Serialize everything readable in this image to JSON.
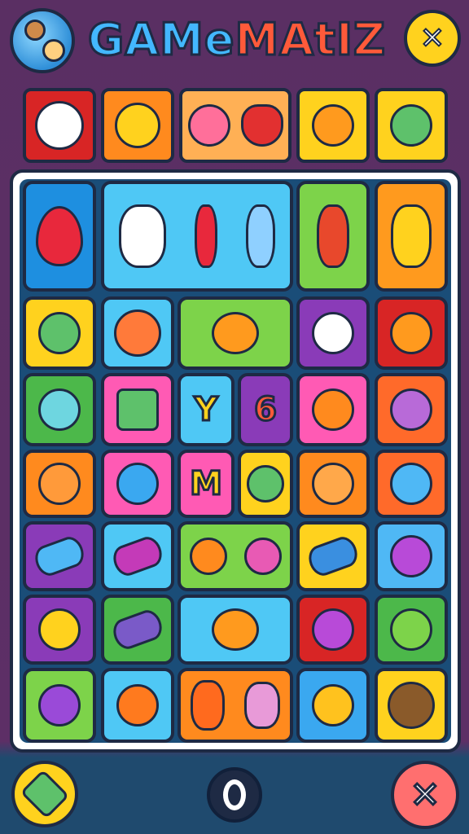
{
  "header": {
    "title_part1": "GAMe",
    "title_part2": "MAtIZ",
    "globe_icon": "globe-mascot-icon",
    "close_icon": "close-x-icon"
  },
  "top_row": [
    {
      "icon": "cat-face-icon",
      "color": "#d82525"
    },
    {
      "icon": "fox-face-icon",
      "color": "#ff8a1e"
    },
    {
      "icon": "flower-strawberry-icon",
      "color": "#ffb055"
    },
    {
      "icon": "orange-cat-icon",
      "color": "#ffd21e"
    },
    {
      "icon": "alien-face-icon",
      "color": "#ffd21e"
    }
  ],
  "board": {
    "letters": {
      "y": "Y",
      "six": "6",
      "m": "M"
    }
  },
  "footer": {
    "leaf_icon": "leaf-icon",
    "center_icon": "ring-icon",
    "close_icon": "close-x-icon"
  }
}
